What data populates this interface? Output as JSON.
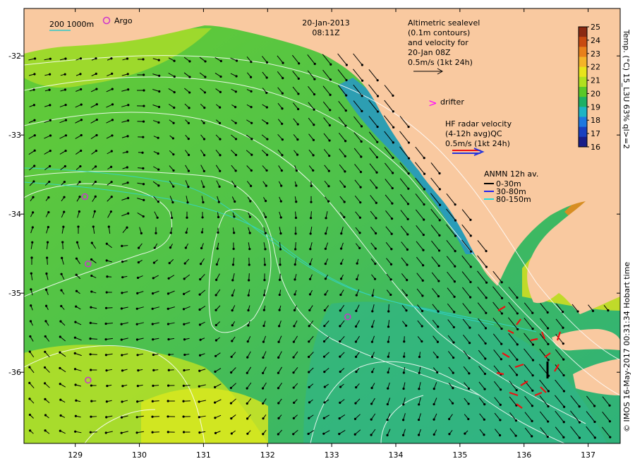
{
  "header": {
    "date": "20-Jan-2013",
    "time": "08:11Z"
  },
  "scale_bar": {
    "label": "200  1000m",
    "color": "#30c8c8"
  },
  "argo": {
    "label": "Argo",
    "color": "#cc33cc",
    "floats": [
      {
        "lon": 129.15,
        "lat": -33.78
      },
      {
        "lon": 129.2,
        "lat": -34.63
      },
      {
        "lon": 133.25,
        "lat": -35.3
      },
      {
        "lon": 129.2,
        "lat": -36.1
      }
    ]
  },
  "altimetry": {
    "lines": [
      "Altimetric sealevel",
      "(0.1m contours)",
      "and velocity for",
      "20-Jan 08Z",
      "0.5m/s (1kt 24h)"
    ]
  },
  "drifter": {
    "symbol": ">",
    "label": "drifter",
    "color": "#ff00ff"
  },
  "hf_radar": {
    "lines": [
      "HF radar velocity",
      "(4-12h avg)QC",
      "0.5m/s (1kt 24h)"
    ],
    "colors": [
      "#ee1111",
      "#2233dd"
    ]
  },
  "anmn": {
    "title": "ANMN 12h av.",
    "entries": [
      {
        "label": "0-30m",
        "color": "#000000"
      },
      {
        "label": "30-80m",
        "color": "#2222ee"
      },
      {
        "label": "80-150m",
        "color": "#22dddd"
      }
    ]
  },
  "colorbar": {
    "title": "Temp. (°C) 15_L3U 63% ql>=2",
    "ticks": [
      "25",
      "24",
      "23",
      "22",
      "21",
      "20",
      "19",
      "18",
      "17",
      "16"
    ],
    "colors": [
      "#8b2a12",
      "#c84a10",
      "#e8801a",
      "#f4b428",
      "#e8e41a",
      "#b0e01e",
      "#5ac828",
      "#1eb064",
      "#1eb4c4",
      "#1e78e0",
      "#1a40c0",
      "#1a1e88"
    ]
  },
  "credit": "© IMOS 16-May-2017 00:31:34 Hobart time",
  "axes": {
    "x_ticks": [
      "129",
      "130",
      "131",
      "132",
      "133",
      "134",
      "135",
      "136",
      "137"
    ],
    "y_ticks": [
      "-32",
      "-33",
      "-34",
      "-35",
      "-36"
    ],
    "lon_range": [
      128.2,
      137.5
    ],
    "lat_range": [
      -36.9,
      -31.4
    ]
  },
  "colors": {
    "land": "#f9c9a0",
    "sea_base": "#5cc83a",
    "contour": "#ffffff",
    "arrow": "#000000"
  }
}
